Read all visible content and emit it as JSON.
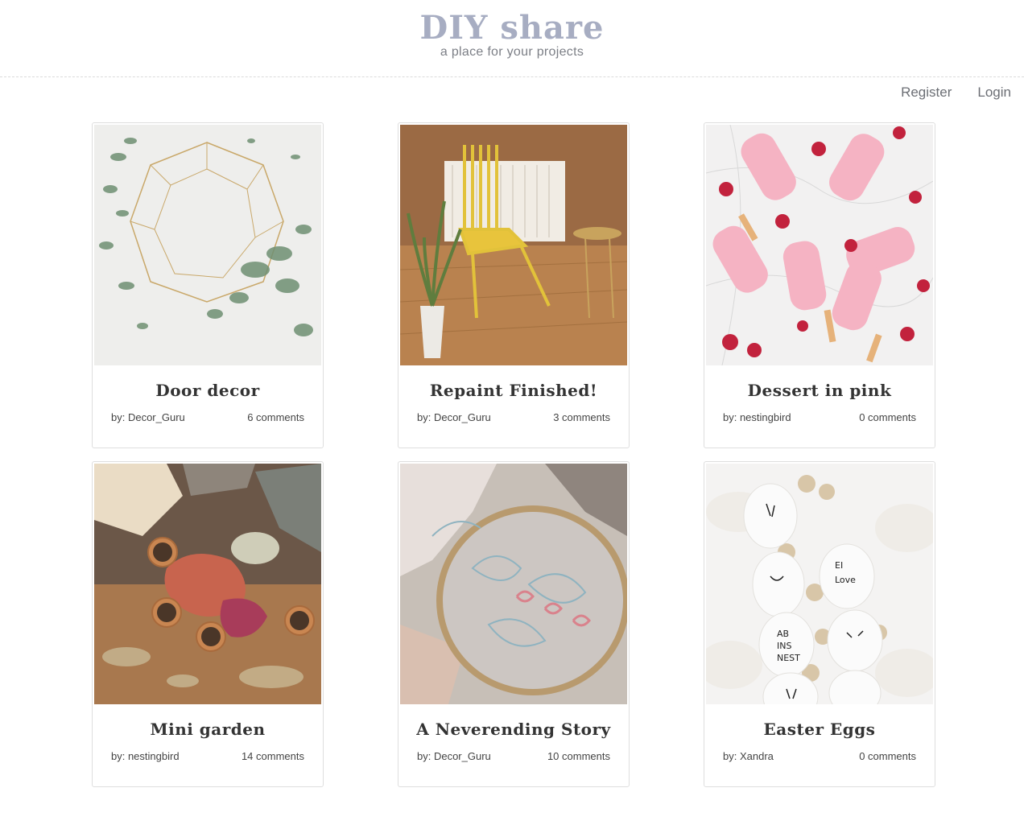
{
  "header": {
    "logo": "DIY share",
    "tagline": "a place for your projects"
  },
  "nav": {
    "register": "Register",
    "login": "Login"
  },
  "projects": [
    {
      "title": "Door decor",
      "author": "by: Decor_Guru",
      "comments": "6 comments"
    },
    {
      "title": "Repaint Finished!",
      "author": "by: Decor_Guru",
      "comments": "3 comments"
    },
    {
      "title": "Dessert in pink",
      "author": "by: nestingbird",
      "comments": "0 comments"
    },
    {
      "title": "Mini garden",
      "author": "by: nestingbird",
      "comments": "14 comments"
    },
    {
      "title": "A Neverending Story",
      "author": "by: Decor_Guru",
      "comments": "10 comments"
    },
    {
      "title": "Easter Eggs",
      "author": "by: Xandra",
      "comments": "0 comments"
    }
  ],
  "colors": {
    "logo": "#a7adc2",
    "nav_text": "#6b6e74",
    "card_border": "#dedede"
  }
}
